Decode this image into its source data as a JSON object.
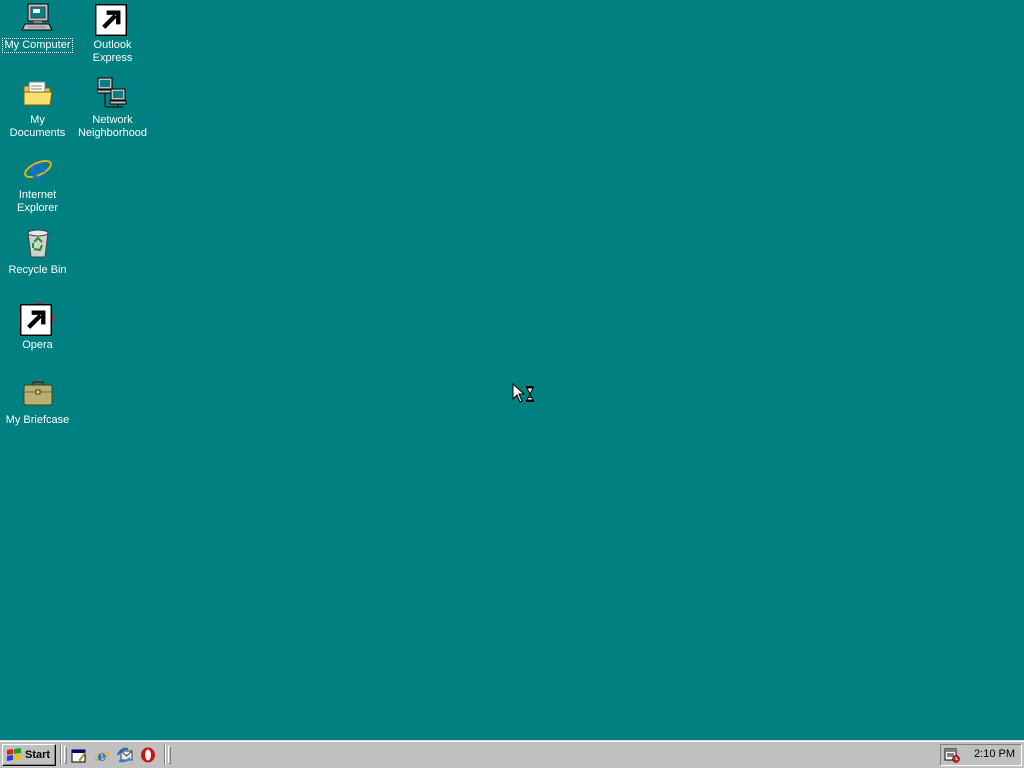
{
  "desktop": {
    "background": "#008080",
    "icons": [
      {
        "label": "My Computer"
      },
      {
        "label": "Outlook\nExpress"
      },
      {
        "label": "My Documents"
      },
      {
        "label": "Network\nNeighborhood"
      },
      {
        "label": "Internet\nExplorer"
      },
      {
        "label": "Recycle Bin"
      },
      {
        "label": "Opera"
      },
      {
        "label": "My Briefcase"
      }
    ]
  },
  "taskbar": {
    "start_label": "Start",
    "quick_launch": [
      "show-desktop-icon",
      "internet-explorer-icon",
      "outlook-express-icon",
      "opera-icon"
    ],
    "clock": "2:10 PM"
  },
  "cursor": "busy-arrow-hourglass"
}
